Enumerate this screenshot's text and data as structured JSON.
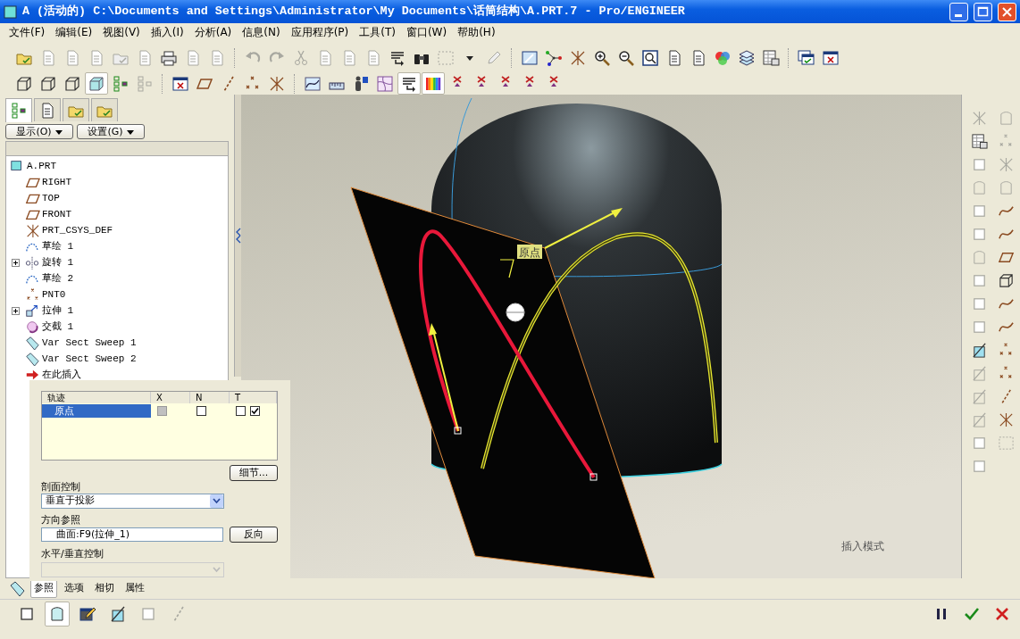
{
  "window": {
    "title": "A (活动的) C:\\Documents and Settings\\Administrator\\My Documents\\话筒结构\\A.PRT.7 - Pro/ENGINEER"
  },
  "menu": [
    "文件(F)",
    "编辑(E)",
    "视图(V)",
    "插入(I)",
    "分析(A)",
    "信息(N)",
    "应用程序(P)",
    "工具(T)",
    "窗口(W)",
    "帮助(H)"
  ],
  "navigator": {
    "tabs": [
      {
        "kind": "tree",
        "selected": true
      },
      {
        "kind": "layers",
        "selected": false
      },
      {
        "kind": "favorites",
        "selected": false
      },
      {
        "kind": "tools",
        "selected": false
      }
    ],
    "buttons": [
      "显示(O)",
      "设置(G)"
    ],
    "tree": [
      {
        "label": "A.PRT",
        "kind": "part",
        "collapsed": false,
        "children": [
          {
            "label": "RIGHT",
            "kind": "plane",
            "collapsed": false
          },
          {
            "label": "TOP",
            "kind": "plane",
            "collapsed": false
          },
          {
            "label": "FRONT",
            "kind": "plane",
            "collapsed": false
          },
          {
            "label": "PRT_CSYS_DEF",
            "kind": "csys",
            "collapsed": false
          },
          {
            "label": "草绘 1",
            "kind": "sketch",
            "collapsed": false
          },
          {
            "label": "旋转 1",
            "kind": "revolve",
            "collapsed": true
          },
          {
            "label": "草绘 2",
            "kind": "sketch",
            "collapsed": false
          },
          {
            "label": "PNT0",
            "kind": "point",
            "collapsed": false
          },
          {
            "label": "拉伸 1",
            "kind": "extrude",
            "collapsed": true
          },
          {
            "label": "交截 1",
            "kind": "intersect",
            "collapsed": false
          },
          {
            "label": "Var Sect Sweep 1",
            "kind": "sweep",
            "collapsed": false
          },
          {
            "label": "Var Sect Sweep 2",
            "kind": "sweep",
            "collapsed": false
          },
          {
            "label": "在此插入",
            "kind": "insert",
            "collapsed": false
          }
        ]
      }
    ]
  },
  "dashboard_panel": {
    "table": {
      "columns": [
        "轨迹",
        "X",
        "N",
        "T"
      ],
      "rows": [
        {
          "name": "原点",
          "selected": true,
          "x": {
            "checked": false,
            "disabled": true
          },
          "n": {
            "checked": false,
            "disabled": false
          },
          "t": [
            {
              "checked": false
            },
            {
              "checked": true
            }
          ]
        }
      ]
    },
    "details_button": "细节...",
    "section_control": {
      "label": "剖面控制",
      "value": "垂直于投影"
    },
    "direction_reference": {
      "label": "方向参照",
      "value": "曲面:F9(拉伸_1)",
      "button": "反向"
    },
    "hv_control": {
      "label": "水平/垂直控制",
      "disabled": true
    }
  },
  "dashboard_tabs": [
    {
      "label": "参照",
      "selected": true
    },
    {
      "label": "选项",
      "selected": false
    },
    {
      "label": "相切",
      "selected": false
    },
    {
      "label": "属性",
      "selected": false
    }
  ],
  "canvas": {
    "point_label": "原点",
    "mode": "插入模式"
  }
}
